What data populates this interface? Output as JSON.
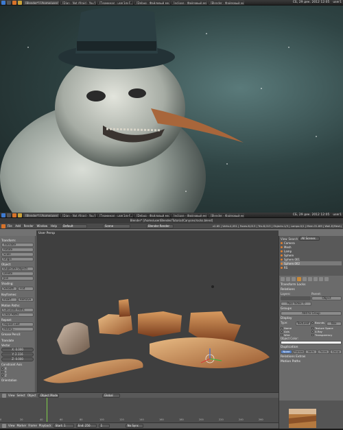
{
  "top_taskbar": {
    "tasks": [
      "[Blender*] [/home/user/...",
      "[Djan - Not Afraid - You'l...",
      "[Терминал - user1@-F...",
      "[Debug - Файловый ме...",
      "[eclipse - Файловый ме...",
      "[Blender - Файловый ме..."
    ],
    "clock": "СБ, 29 дек. 2012 12:05",
    "user": "user1"
  },
  "bottom_taskbar": {
    "tasks": [
      "[Blender*] [/home/user/...",
      "[Djan - Not Afraid - You'l...",
      "[Терминал - user1@-F...",
      "[Debug - Файловый ме...",
      "[eclipse - Файловый ме...",
      "[Blender - Файловый ме..."
    ],
    "clock": "СБ, 29 дек. 2012 12:05",
    "user": "user1"
  },
  "blender": {
    "window_title": "Blender* [/home/user/Blender/Tutorial/Canyons/rocks.blend]",
    "menu": [
      "File",
      "Add",
      "Render",
      "Window",
      "Help"
    ],
    "layout": "Default",
    "scene": "Scene",
    "engine": "Blender Render",
    "stats": "v2.65 | Verts:4,051 | Faces:8,013 | Tris:8,013 | Objects:1/3 | Lamps:0/1 | Mem:31.8M | Wall-E(Mesh)"
  },
  "toolshelf": {
    "transform_header": "Transform:",
    "transform": [
      "Translate",
      "Rotate",
      "Scale",
      "Origin"
    ],
    "object_header": "Object:",
    "object": [
      "Duplicate Objects",
      "Delete",
      "Join"
    ],
    "shading_header": "Shading:",
    "shading": [
      "Smooth",
      "Flat"
    ],
    "keyframes_header": "Keyframes:",
    "keyframes": [
      "Insert",
      "Remove"
    ],
    "motion_header": "Motion Paths:",
    "motion": [
      "Calculate Paths",
      "Clear Paths"
    ],
    "repeat_header": "Repeat:",
    "repeat": [
      "Repeat Last",
      "History..."
    ],
    "grease": [
      "Grease Pencil:"
    ],
    "translate_header": "Translate",
    "vector_label": "Vector",
    "vector": [
      "X: 0.000",
      "Y: 2.116",
      "Z: 0.000"
    ],
    "constraint_label": "Constraint Axis",
    "axes": [
      "X",
      "Y",
      "Z"
    ],
    "orientation": "Orientation"
  },
  "viewport": {
    "label": "User Persp",
    "frame": "(1) (1)"
  },
  "viewport_header": {
    "items": [
      "View",
      "Select",
      "Object",
      "Object Mode",
      "Global"
    ]
  },
  "timeline": {
    "ruler": [
      "0",
      "20",
      "40",
      "60",
      "80",
      "100",
      "120",
      "140",
      "160",
      "180",
      "200",
      "220",
      "240",
      "260"
    ],
    "items": [
      "View",
      "Marker",
      "Frame",
      "Playback",
      "Start: 1",
      "End: 250",
      "1",
      "No Sync"
    ]
  },
  "outliner": {
    "view": "View",
    "search": "Search",
    "filter": "All Scenes",
    "items": [
      "Camera",
      "Mesh",
      "Lamp",
      "Sphere",
      "Sphere.001",
      "Sphere.002",
      "RS"
    ]
  },
  "properties": {
    "transform_locks": "Transform Locks",
    "relations": "Relations",
    "layers_label": "Layers:",
    "parent_label": "Parent:",
    "pass_index": "Pass Index: 0",
    "object_label": "Object",
    "groups": "Groups",
    "add_to_group": "Add to Group",
    "display": "Display",
    "type_label": "Type:",
    "type_value": "Textured",
    "bounds": "Bounds",
    "box": "Box",
    "checks_left": [
      "Name",
      "Axis",
      "Wire"
    ],
    "checks_right": [
      "Texture Space",
      "X-Ray",
      "Transparency"
    ],
    "object_color": "Object Color:",
    "duplication": "Duplication",
    "dup_tabs": [
      "None",
      "Frames",
      "Verts",
      "Faces",
      "Group"
    ],
    "relations_extras": "Relations Extras",
    "motion_paths": "Motion Paths"
  }
}
